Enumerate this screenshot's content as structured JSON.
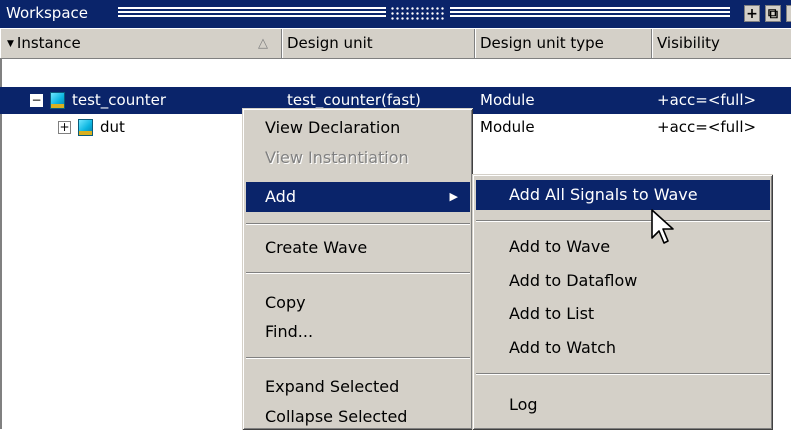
{
  "titlebar": {
    "title": "Workspace",
    "btn_plus": "+",
    "btn_restore": "⧉",
    "btn_close": "✕"
  },
  "columns": {
    "instance": "Instance",
    "design_unit": "Design unit",
    "design_unit_type": "Design unit type",
    "visibility": "Visibility"
  },
  "rows": [
    {
      "instance": "test_counter",
      "design_unit": "test_counter(fast)",
      "type": "Module",
      "visibility": "+acc=<full>"
    },
    {
      "instance": "dut",
      "design_unit": "",
      "type": "Module",
      "visibility": "+acc=<full>"
    }
  ],
  "context_menu": {
    "view_declaration": "View Declaration",
    "view_instantiation": "View Instantiation",
    "add": "Add",
    "create_wave": "Create Wave",
    "copy": "Copy",
    "find": "Find...",
    "expand_selected": "Expand Selected",
    "collapse_selected": "Collapse Selected"
  },
  "submenu": {
    "add_all_signals": "Add All Signals to Wave",
    "add_to_wave": "Add to Wave",
    "add_to_dataflow": "Add to Dataflow",
    "add_to_list": "Add to List",
    "add_to_watch": "Add to Watch",
    "log": "Log"
  },
  "colors": {
    "selection": "#0a246a",
    "menu_bg": "#d4d0c8",
    "module_icon": "#0bb5e0"
  }
}
